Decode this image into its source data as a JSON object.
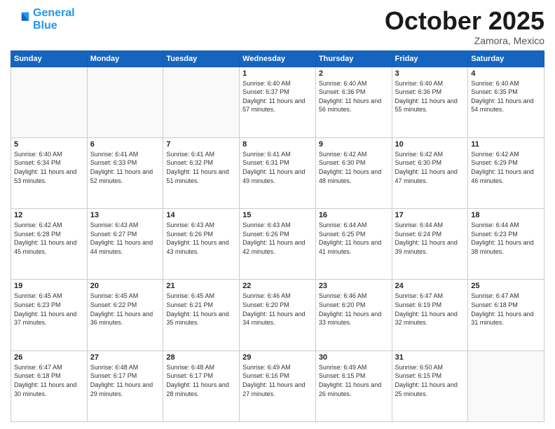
{
  "header": {
    "logo_line1": "General",
    "logo_line2": "Blue",
    "month": "October 2025",
    "location": "Zamora, Mexico"
  },
  "days_of_week": [
    "Sunday",
    "Monday",
    "Tuesday",
    "Wednesday",
    "Thursday",
    "Friday",
    "Saturday"
  ],
  "weeks": [
    [
      {
        "day": "",
        "sunrise": "",
        "sunset": "",
        "daylight": ""
      },
      {
        "day": "",
        "sunrise": "",
        "sunset": "",
        "daylight": ""
      },
      {
        "day": "",
        "sunrise": "",
        "sunset": "",
        "daylight": ""
      },
      {
        "day": "1",
        "sunrise": "Sunrise: 6:40 AM",
        "sunset": "Sunset: 6:37 PM",
        "daylight": "Daylight: 11 hours and 57 minutes."
      },
      {
        "day": "2",
        "sunrise": "Sunrise: 6:40 AM",
        "sunset": "Sunset: 6:36 PM",
        "daylight": "Daylight: 11 hours and 56 minutes."
      },
      {
        "day": "3",
        "sunrise": "Sunrise: 6:40 AM",
        "sunset": "Sunset: 6:36 PM",
        "daylight": "Daylight: 11 hours and 55 minutes."
      },
      {
        "day": "4",
        "sunrise": "Sunrise: 6:40 AM",
        "sunset": "Sunset: 6:35 PM",
        "daylight": "Daylight: 11 hours and 54 minutes."
      }
    ],
    [
      {
        "day": "5",
        "sunrise": "Sunrise: 6:40 AM",
        "sunset": "Sunset: 6:34 PM",
        "daylight": "Daylight: 11 hours and 53 minutes."
      },
      {
        "day": "6",
        "sunrise": "Sunrise: 6:41 AM",
        "sunset": "Sunset: 6:33 PM",
        "daylight": "Daylight: 11 hours and 52 minutes."
      },
      {
        "day": "7",
        "sunrise": "Sunrise: 6:41 AM",
        "sunset": "Sunset: 6:32 PM",
        "daylight": "Daylight: 11 hours and 51 minutes."
      },
      {
        "day": "8",
        "sunrise": "Sunrise: 6:41 AM",
        "sunset": "Sunset: 6:31 PM",
        "daylight": "Daylight: 11 hours and 49 minutes."
      },
      {
        "day": "9",
        "sunrise": "Sunrise: 6:42 AM",
        "sunset": "Sunset: 6:30 PM",
        "daylight": "Daylight: 11 hours and 48 minutes."
      },
      {
        "day": "10",
        "sunrise": "Sunrise: 6:42 AM",
        "sunset": "Sunset: 6:30 PM",
        "daylight": "Daylight: 11 hours and 47 minutes."
      },
      {
        "day": "11",
        "sunrise": "Sunrise: 6:42 AM",
        "sunset": "Sunset: 6:29 PM",
        "daylight": "Daylight: 11 hours and 46 minutes."
      }
    ],
    [
      {
        "day": "12",
        "sunrise": "Sunrise: 6:42 AM",
        "sunset": "Sunset: 6:28 PM",
        "daylight": "Daylight: 11 hours and 45 minutes."
      },
      {
        "day": "13",
        "sunrise": "Sunrise: 6:43 AM",
        "sunset": "Sunset: 6:27 PM",
        "daylight": "Daylight: 11 hours and 44 minutes."
      },
      {
        "day": "14",
        "sunrise": "Sunrise: 6:43 AM",
        "sunset": "Sunset: 6:26 PM",
        "daylight": "Daylight: 11 hours and 43 minutes."
      },
      {
        "day": "15",
        "sunrise": "Sunrise: 6:43 AM",
        "sunset": "Sunset: 6:26 PM",
        "daylight": "Daylight: 11 hours and 42 minutes."
      },
      {
        "day": "16",
        "sunrise": "Sunrise: 6:44 AM",
        "sunset": "Sunset: 6:25 PM",
        "daylight": "Daylight: 11 hours and 41 minutes."
      },
      {
        "day": "17",
        "sunrise": "Sunrise: 6:44 AM",
        "sunset": "Sunset: 6:24 PM",
        "daylight": "Daylight: 11 hours and 39 minutes."
      },
      {
        "day": "18",
        "sunrise": "Sunrise: 6:44 AM",
        "sunset": "Sunset: 6:23 PM",
        "daylight": "Daylight: 11 hours and 38 minutes."
      }
    ],
    [
      {
        "day": "19",
        "sunrise": "Sunrise: 6:45 AM",
        "sunset": "Sunset: 6:23 PM",
        "daylight": "Daylight: 11 hours and 37 minutes."
      },
      {
        "day": "20",
        "sunrise": "Sunrise: 6:45 AM",
        "sunset": "Sunset: 6:22 PM",
        "daylight": "Daylight: 11 hours and 36 minutes."
      },
      {
        "day": "21",
        "sunrise": "Sunrise: 6:45 AM",
        "sunset": "Sunset: 6:21 PM",
        "daylight": "Daylight: 11 hours and 35 minutes."
      },
      {
        "day": "22",
        "sunrise": "Sunrise: 6:46 AM",
        "sunset": "Sunset: 6:20 PM",
        "daylight": "Daylight: 11 hours and 34 minutes."
      },
      {
        "day": "23",
        "sunrise": "Sunrise: 6:46 AM",
        "sunset": "Sunset: 6:20 PM",
        "daylight": "Daylight: 11 hours and 33 minutes."
      },
      {
        "day": "24",
        "sunrise": "Sunrise: 6:47 AM",
        "sunset": "Sunset: 6:19 PM",
        "daylight": "Daylight: 11 hours and 32 minutes."
      },
      {
        "day": "25",
        "sunrise": "Sunrise: 6:47 AM",
        "sunset": "Sunset: 6:18 PM",
        "daylight": "Daylight: 11 hours and 31 minutes."
      }
    ],
    [
      {
        "day": "26",
        "sunrise": "Sunrise: 6:47 AM",
        "sunset": "Sunset: 6:18 PM",
        "daylight": "Daylight: 11 hours and 30 minutes."
      },
      {
        "day": "27",
        "sunrise": "Sunrise: 6:48 AM",
        "sunset": "Sunset: 6:17 PM",
        "daylight": "Daylight: 11 hours and 29 minutes."
      },
      {
        "day": "28",
        "sunrise": "Sunrise: 6:48 AM",
        "sunset": "Sunset: 6:17 PM",
        "daylight": "Daylight: 11 hours and 28 minutes."
      },
      {
        "day": "29",
        "sunrise": "Sunrise: 6:49 AM",
        "sunset": "Sunset: 6:16 PM",
        "daylight": "Daylight: 11 hours and 27 minutes."
      },
      {
        "day": "30",
        "sunrise": "Sunrise: 6:49 AM",
        "sunset": "Sunset: 6:15 PM",
        "daylight": "Daylight: 11 hours and 26 minutes."
      },
      {
        "day": "31",
        "sunrise": "Sunrise: 6:50 AM",
        "sunset": "Sunset: 6:15 PM",
        "daylight": "Daylight: 11 hours and 25 minutes."
      },
      {
        "day": "",
        "sunrise": "",
        "sunset": "",
        "daylight": ""
      }
    ]
  ]
}
